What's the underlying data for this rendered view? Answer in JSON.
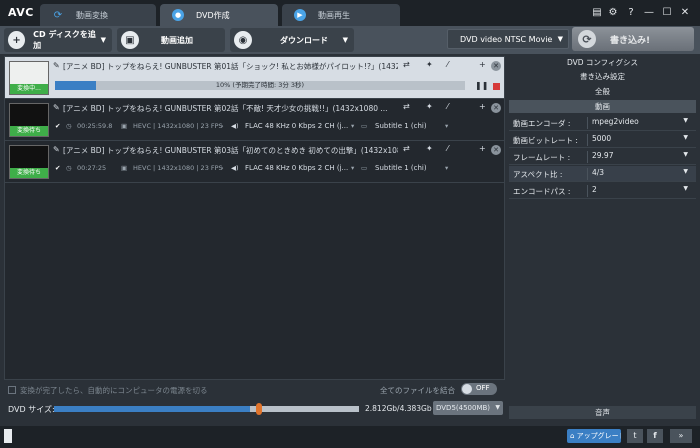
{
  "app": {
    "name": "AVC"
  },
  "tabs": [
    {
      "label": "動画変換"
    },
    {
      "label": "DVD作成"
    },
    {
      "label": "動画再生"
    }
  ],
  "toolbar": {
    "cd_add_label": "CD ディスクを追加",
    "video_add_label": "動画追加",
    "download_label": "ダウンロード",
    "format_value": "DVD video NTSC Movie",
    "burn_label": "書き込み!"
  },
  "files": [
    {
      "title": "[アニメ BD] トップをねらえ! GUNBUSTER 第01話「ショック! 私とお姉様がパイロット!?」(1432...",
      "thumb_label": "変換中...",
      "progress_text": "10% (予期完了時間: 3分 3秒)",
      "progress": 0.1
    },
    {
      "title": "[アニメ BD] トップをねらえ! GUNBUSTER 第02話「不敵! 天才少女の挑戦!!」(1432x1080 ...",
      "thumb_label": "変換待ち",
      "duration": "00:25:59.8",
      "video": "HEVC | 1432x1080 | 23 FPS",
      "audio": "FLAC 48 KHz 0 Kbps 2 CH (j...",
      "subtitle": "Subtitle 1 (chi)"
    },
    {
      "title": "[アニメ BD] トップをねらえ! GUNBUSTER 第03話「初めてのときめき 初めての出撃」(1432x108...",
      "thumb_label": "変換待ち",
      "duration": "00:27:25",
      "video": "HEVC | 1432x1080 | 23 FPS",
      "audio": "FLAC 48 KHz 0 Kbps 2 CH (j...",
      "subtitle": "Subtitle 1 (chi)"
    }
  ],
  "bottom": {
    "shutdown_label": "変換が完了したら、自動的にコンピュータの電源を切る",
    "merge_label": "全てのファイルを結合",
    "merge_toggle": "OFF",
    "dvd_size_label": "DVD サイズ:",
    "size_text": "2.812Gb/4.383Gb",
    "disc_type": "DVD5(4500MB)",
    "size_fraction": 0.642
  },
  "panel": {
    "title": "DVD コンフィグシス",
    "sections": [
      "書き込み設定",
      "全般",
      "動画"
    ],
    "rows": [
      {
        "key": "動画エンコーダ :",
        "value": "mpeg2video"
      },
      {
        "key": "動画ビットレート :",
        "value": "5000"
      },
      {
        "key": "フレームレート :",
        "value": "29.97"
      },
      {
        "key": "アスペクト比 :",
        "value": "4/3"
      },
      {
        "key": "エンコードパス :",
        "value": "2"
      }
    ],
    "audio_section": "音声"
  },
  "footer": {
    "upgrade_label": "アップグレード"
  },
  "colors": {
    "accent": "#3b7fc4",
    "green": "#3fae49",
    "marker": "#e0742c"
  }
}
